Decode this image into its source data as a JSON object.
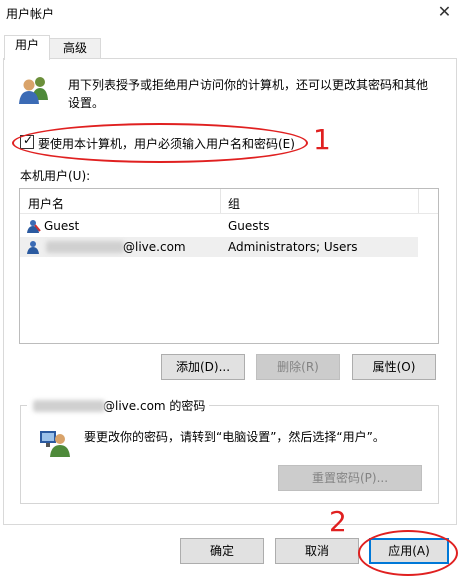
{
  "window": {
    "title": "用户帐户",
    "close_glyph": "✕"
  },
  "tabs": [
    {
      "label": "用户",
      "active": true
    },
    {
      "label": "高级",
      "active": false
    }
  ],
  "intro": {
    "text": "用下列表授予或拒绝用户访问你的计算机，还可以更改其密码和其他设置。"
  },
  "require_login": {
    "label": "要使用本计算机，用户必须输入用户名和密码(E)",
    "checked": true
  },
  "users": {
    "label": "本机用户(U):",
    "columns": [
      "用户名",
      "组"
    ],
    "rows": [
      {
        "name": "Guest",
        "group": "Guests",
        "selected": false
      },
      {
        "name": "@live.com",
        "group": "Administrators; Users",
        "selected": true
      }
    ]
  },
  "user_buttons": {
    "add": "添加(D)...",
    "remove": "删除(R)",
    "properties": "属性(O)"
  },
  "password_group": {
    "title": "@live.com 的密码",
    "text": "要更改你的密码，请转到“电脑设置”，然后选择“用户”。",
    "reset_button": "重置密码(P)..."
  },
  "dialog_buttons": {
    "ok": "确定",
    "cancel": "取消",
    "apply": "应用(A)"
  },
  "annotations": {
    "marker1": "1",
    "marker2": "2",
    "color": "#e02020"
  },
  "colors": {
    "accent": "#0078d7"
  }
}
